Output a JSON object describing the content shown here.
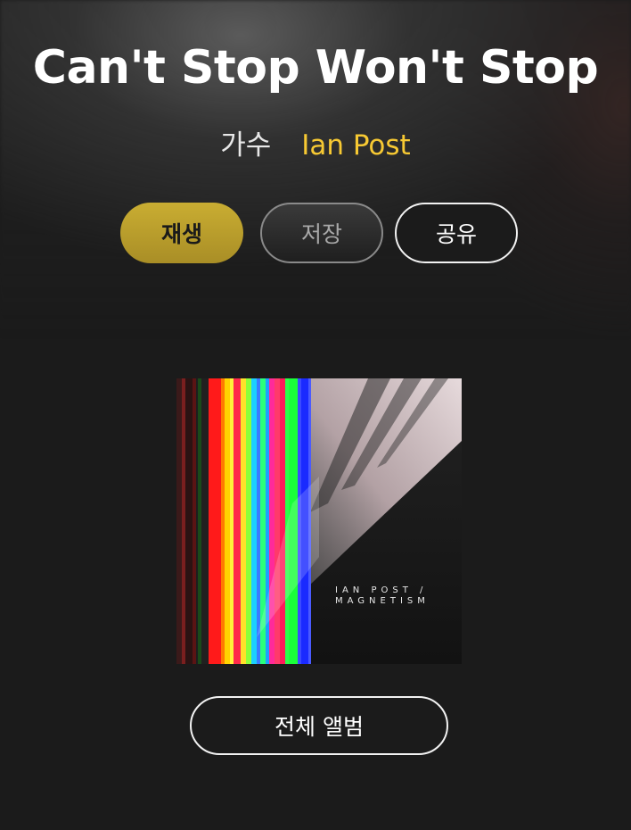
{
  "song": {
    "title": "Can't Stop Won't Stop",
    "artist_label": "가수",
    "artist_name": "Ian Post"
  },
  "actions": {
    "play_label": "재생",
    "save_label": "저장",
    "share_label": "공유"
  },
  "album": {
    "cover_artist_text": "IAN POST /",
    "cover_album_text": "MAGNETISM",
    "full_album_label": "전체 앨범"
  },
  "colors": {
    "background": "#1b1b1b",
    "accent_yellow": "#f7c933",
    "play_button": "#bfa22d"
  }
}
